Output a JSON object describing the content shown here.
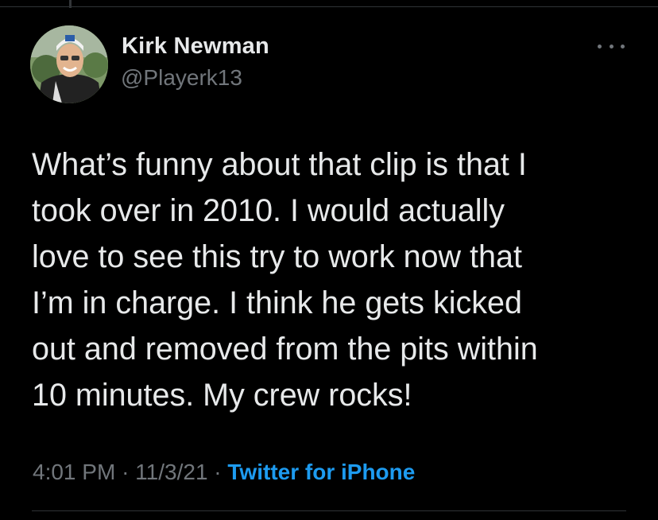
{
  "tweet": {
    "author": {
      "name": "Kirk Newman",
      "handle": "@Playerk13"
    },
    "text": "What’s funny about that clip is that I\ntook over in 2010. I would actually\nlove to see this try to work now that\nI’m in charge. I think he gets kicked\nout and removed from the pits within\n10 minutes. My crew rocks!",
    "time": "4:01 PM",
    "separator": "·",
    "date": "11/3/21",
    "source": "Twitter for iPhone"
  },
  "colors": {
    "background": "#000000",
    "primary_text": "#e7e9ea",
    "secondary_text": "#71767b",
    "link": "#1d9bf0",
    "divider": "#2f3336"
  },
  "icons": {
    "more": "more-horizontal-icon"
  }
}
